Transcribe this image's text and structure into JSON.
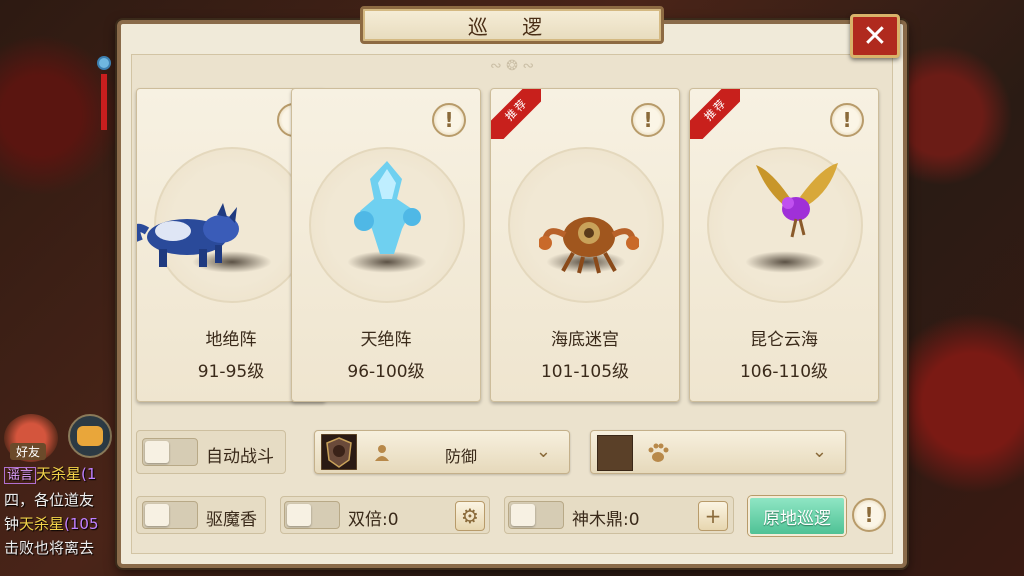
{
  "window": {
    "title": "巡 逻",
    "close_symbol": "✕"
  },
  "chat": {
    "friend_label": "好友",
    "lines": [
      {
        "tag": "谣言",
        "name": "天杀星",
        "rest": "(1"
      },
      {
        "text": "四，各位道友"
      },
      {
        "prefix": "钟",
        "name": "天杀星",
        "rest": "(105"
      },
      {
        "text": "击败也将离去"
      }
    ]
  },
  "cards": [
    {
      "name": "地绝阵",
      "level": "91-95级",
      "recommended": false,
      "monster": "blue-wolf"
    },
    {
      "name": "天绝阵",
      "level": "96-100级",
      "recommended": false,
      "monster": "ice-spirit"
    },
    {
      "name": "海底迷宫",
      "level": "101-105级",
      "recommended": true,
      "monster": "crab"
    },
    {
      "name": "昆仑云海",
      "level": "106-110级",
      "recommended": true,
      "monster": "purple-bird"
    }
  ],
  "recommend_label": "推荐",
  "info_symbol": "!",
  "controls": {
    "auto_battle_label": "自动战斗",
    "stance_label": "防御",
    "chevron": "⌄",
    "repel_label": "驱魔香",
    "double_label": "双倍:0",
    "shenmu_label": "神木鼎:0",
    "patrol_button": "原地巡逻",
    "plus_symbol": "+",
    "gear_symbol": "⚙"
  }
}
